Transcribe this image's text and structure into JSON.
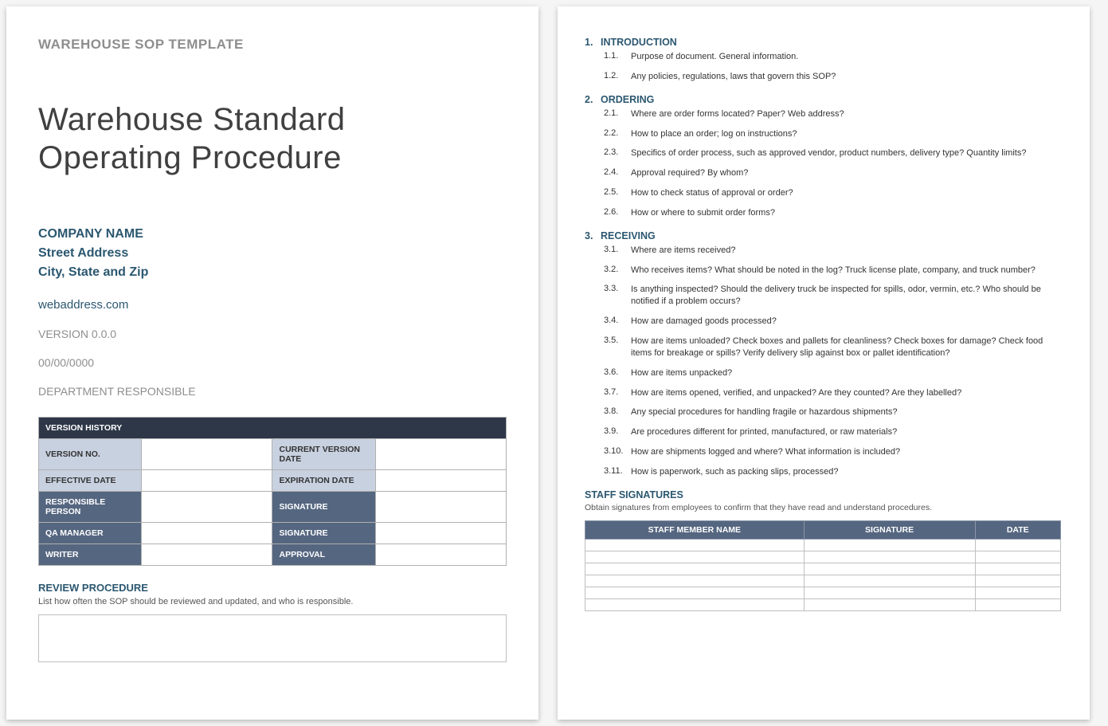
{
  "page1": {
    "template_header": "WAREHOUSE SOP TEMPLATE",
    "title_line1": "Warehouse Standard",
    "title_line2": "Operating Procedure",
    "company": {
      "name": "COMPANY NAME",
      "street": "Street Address",
      "city": "City, State and Zip"
    },
    "web": "webaddress.com",
    "version": "VERSION 0.0.0",
    "date": "00/00/0000",
    "dept": "DEPARTMENT RESPONSIBLE",
    "version_table": {
      "header": "VERSION HISTORY",
      "rows": {
        "r1a": "VERSION NO.",
        "r1b": "CURRENT VERSION DATE",
        "r2a": "EFFECTIVE DATE",
        "r2b": "EXPIRATION DATE",
        "r3a": "RESPONSIBLE PERSON",
        "r3b": "SIGNATURE",
        "r4a": "QA MANAGER",
        "r4b": "SIGNATURE",
        "r5a": "WRITER",
        "r5b": "APPROVAL"
      }
    },
    "review": {
      "heading": "REVIEW PROCEDURE",
      "sub": "List how often the SOP should be reviewed and updated, and who is responsible."
    }
  },
  "page2": {
    "sections": [
      {
        "num": "1.",
        "title": "INTRODUCTION",
        "items": [
          {
            "num": "1.1.",
            "text": "Purpose of document. General information."
          },
          {
            "num": "1.2.",
            "text": "Any policies, regulations, laws that govern this SOP?"
          }
        ]
      },
      {
        "num": "2.",
        "title": "ORDERING",
        "items": [
          {
            "num": "2.1.",
            "text": "Where are order forms located? Paper? Web address?"
          },
          {
            "num": "2.2.",
            "text": "How to place an order; log on instructions?"
          },
          {
            "num": "2.3.",
            "text": "Specifics of order process, such as approved vendor, product numbers, delivery type? Quantity limits?"
          },
          {
            "num": "2.4.",
            "text": "Approval required? By whom?"
          },
          {
            "num": "2.5.",
            "text": "How to check status of approval or order?"
          },
          {
            "num": "2.6.",
            "text": "How or where to submit order forms?"
          }
        ]
      },
      {
        "num": "3.",
        "title": "RECEIVING",
        "items": [
          {
            "num": "3.1.",
            "text": "Where are items received?"
          },
          {
            "num": "3.2.",
            "text": "Who receives items? What should be noted in the log? Truck license plate, company, and truck number?"
          },
          {
            "num": "3.3.",
            "text": "Is anything inspected? Should the delivery truck be inspected for spills, odor, vermin, etc.? Who should be notified if a problem occurs?"
          },
          {
            "num": "3.4.",
            "text": "How are damaged goods processed?"
          },
          {
            "num": "3.5.",
            "text": "How are items unloaded? Check boxes and pallets for cleanliness? Check boxes for damage? Check food items for breakage or spills? Verify delivery slip against box or pallet identification?"
          },
          {
            "num": "3.6.",
            "text": "How are items unpacked?"
          },
          {
            "num": "3.7.",
            "text": "How are items opened, verified, and unpacked? Are they counted? Are they labelled?"
          },
          {
            "num": "3.8.",
            "text": "Any special procedures for handling fragile or hazardous shipments?"
          },
          {
            "num": "3.9.",
            "text": "Are procedures different for printed, manufactured, or raw materials?"
          },
          {
            "num": "3.10.",
            "text": "How are shipments logged and where? What information is included?"
          },
          {
            "num": "3.11.",
            "text": "How is paperwork, such as packing slips, processed?"
          }
        ]
      }
    ],
    "signatures": {
      "heading": "STAFF SIGNATURES",
      "sub": "Obtain signatures from employees to confirm that they have read and understand procedures.",
      "cols": {
        "c1": "STAFF MEMBER NAME",
        "c2": "SIGNATURE",
        "c3": "DATE"
      },
      "row_count": 6
    }
  }
}
